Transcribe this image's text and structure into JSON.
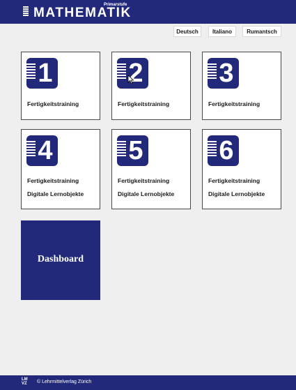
{
  "header": {
    "title": "MATHEMATIK",
    "subtitle": "Primarstufe",
    "logo_icon": "book-lines-icon"
  },
  "languages": [
    "Deutsch",
    "Italiano",
    "Rumantsch"
  ],
  "tiles": [
    {
      "number": "1",
      "lines": [
        "Fertigkeitstraining"
      ]
    },
    {
      "number": "2",
      "lines": [
        "Fertigkeitstraining"
      ]
    },
    {
      "number": "3",
      "lines": [
        "Fertigkeitstraining"
      ]
    },
    {
      "number": "4",
      "lines": [
        "Fertigkeitstraining",
        "Digitale Lernobjekte"
      ]
    },
    {
      "number": "5",
      "lines": [
        "Fertigkeitstraining",
        "Digitale Lernobjekte"
      ]
    },
    {
      "number": "6",
      "lines": [
        "Fertigkeitstraining",
        "Digitale Lernobjekte"
      ]
    }
  ],
  "dashboard": {
    "label": "Dashboard"
  },
  "footer": {
    "logo_top": "LM",
    "logo_bottom": "VZ",
    "copyright": "© Lehrmittelverlag Zürich"
  },
  "colors": {
    "brand": "#22297a",
    "background": "#efefef",
    "tile": "#ffffff"
  }
}
